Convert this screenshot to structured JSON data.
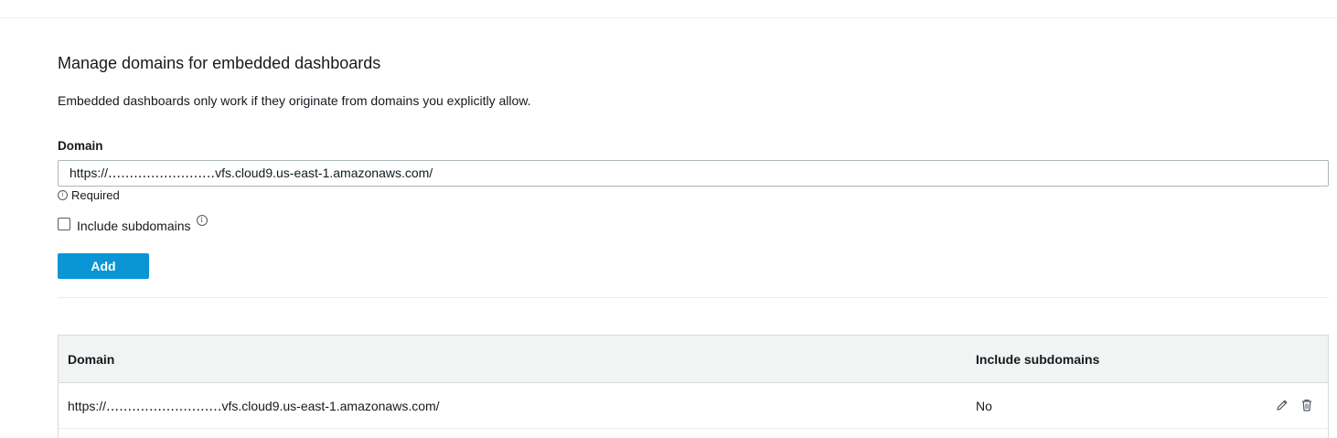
{
  "page": {
    "title": "Manage domains for embedded dashboards",
    "description": "Embedded dashboards only work if they originate from domains you explicitly allow."
  },
  "form": {
    "domain_label": "Domain",
    "domain_value": "https://․․․․․․․․․․․․․․․․․․․․․․․․․vfs.cloud9.us-east-1.amazonaws.com/",
    "required_text": "Required",
    "include_subdomains_label": "Include subdomains",
    "include_subdomains_checked": false,
    "add_button_label": "Add",
    "add_button_color": "#0a95d4"
  },
  "table": {
    "columns": [
      "Domain",
      "Include subdomains"
    ],
    "rows": [
      {
        "domain": "https://․․․․․․․․․․․․․․․․․․․․․․․․․․․vfs.cloud9.us-east-1.amazonaws.com/",
        "include_subdomains": "No",
        "actions": [
          "pencil-icon",
          "trash-icon"
        ]
      }
    ]
  }
}
